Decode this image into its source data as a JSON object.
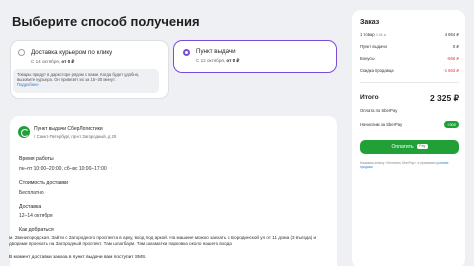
{
  "page": {
    "title": "Выберите способ получения"
  },
  "options": {
    "courier": {
      "title": "Доставка курьером по клику",
      "date": "С 14 октября,",
      "price": "от 0 ₽",
      "notice": "Товары придут в дарксторе рядом с вами. Когда будет удобно, вызовите курьера. Он привезёт их за 15–30 минут.",
      "link": "Подробнее"
    },
    "pickup": {
      "title": "Пункт выдачи",
      "date": "С 12 октября,",
      "price": "от 0 ₽"
    }
  },
  "pickup_point": {
    "name": "Пункт выдачи СберЛогистики",
    "address": "г Санкт-Петербург, пр-кт Загородный, д 20",
    "hours_label": "Время работы",
    "hours_value": "пн–пт 10:00–20:00, сб–вс 10:00–17:00",
    "cost_label": "Стоимость доставки",
    "cost_value": "Бесплатно",
    "delivery_label": "Доставка",
    "delivery_value": "12–14 октября",
    "route_label": "Как добраться",
    "route_text": "м. Звенигородская. Зайти с Загородного проспекта в арку, вход под аркой. На машине можно заехать с Бородинской ул от 11 дома (3 въезда) и дворами проехать на Загородный проспект. Там шлагбаум. Там шахматки парковка около нашего входа",
    "sms_text": "В момент доставки заказа в пункт выдачи вам поступит SMS."
  },
  "summary": {
    "title": "Заказ",
    "rows": [
      {
        "label": "1 товар",
        "note": "0.86 кг",
        "value": "4 654 ₽"
      },
      {
        "label": "Пункт выдачи",
        "value": "0 ₽"
      },
      {
        "label": "Бонусы",
        "value": "-666 ₽"
      },
      {
        "label": "Скидка продавца",
        "value": "-1 663 ₽"
      }
    ],
    "total_label": "Итого",
    "total_value": "2 325 ₽",
    "sberpay_label": "Оплата по SberPay",
    "bonus_label": "Начислим за SberPay",
    "bonus_value": "+300",
    "pay_button": "Оплатить",
    "pay_icon": "Pay",
    "legal_text": "Нажимая кнопку «Оплатить SberPay», я принимаю",
    "legal_link": "условия продажи",
    "colors": {
      "accent": "#21a038",
      "selected": "#7a4dd8",
      "discount": "#e0353a"
    }
  }
}
